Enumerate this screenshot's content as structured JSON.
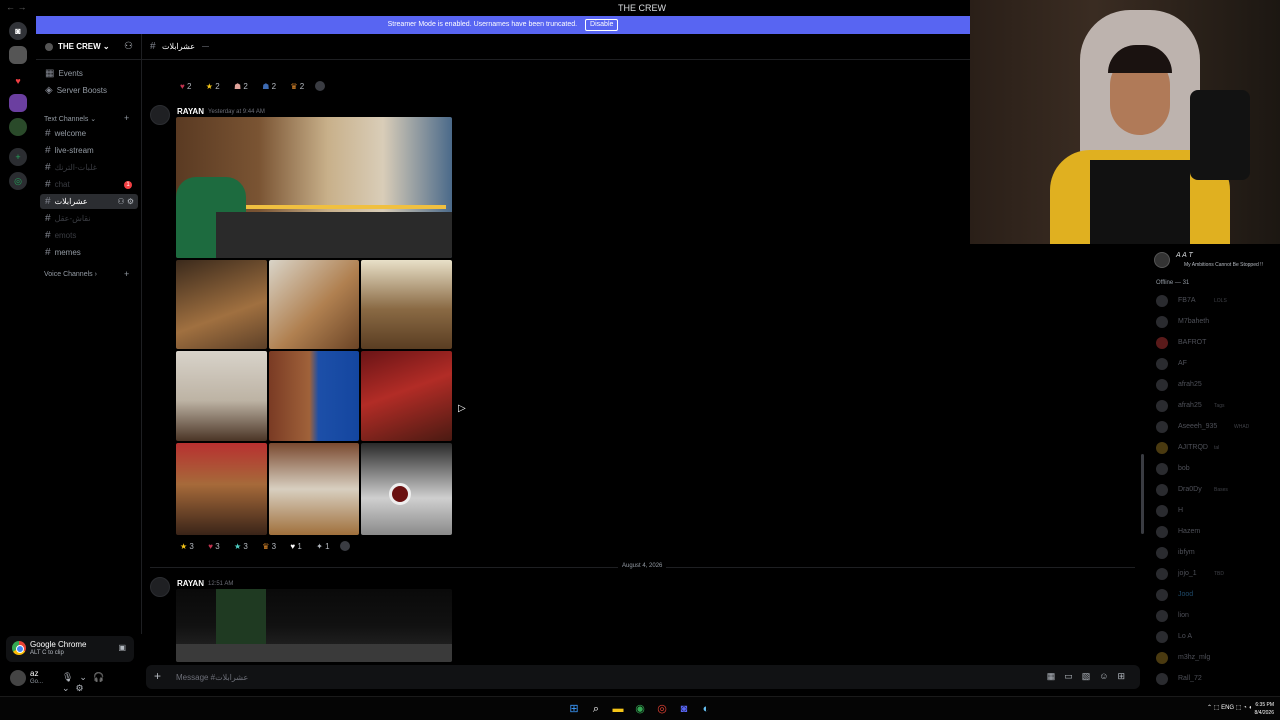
{
  "window": {
    "title": "THE CREW"
  },
  "banner": {
    "text": "Streamer Mode is enabled. Usernames have been truncated.",
    "button": "Disable"
  },
  "server": {
    "name": "THE CREW"
  },
  "sidebar": {
    "top_items": [
      "Events",
      "Server Boosts"
    ],
    "text_category": "Text Channels",
    "channels": [
      {
        "name": "welcome"
      },
      {
        "name": "live-stream"
      },
      {
        "name": "غلبات-الترنك"
      },
      {
        "name": "chat",
        "badge": "1"
      },
      {
        "name": "عشرابلات"
      },
      {
        "name": "نقاش-عقل"
      },
      {
        "name": "emots"
      },
      {
        "name": "memes"
      }
    ],
    "voice_category": "Voice Channels"
  },
  "chat": {
    "channel": "عشرابلات",
    "top_reactions": [
      {
        "emoji": "♥",
        "count": "2",
        "color": "#c2334f"
      },
      {
        "emoji": "★",
        "count": "2",
        "color": "#f5c518"
      },
      {
        "emoji": "☗",
        "count": "2",
        "color": "#e0a39a"
      },
      {
        "emoji": "☗",
        "count": "2",
        "color": "#3d6bb3"
      },
      {
        "emoji": "♛",
        "count": "2",
        "color": "#e08a2b"
      }
    ],
    "messages": [
      {
        "author": "RAYAN",
        "time": "Yesterday at 9:44 AM"
      },
      {
        "author": "RAYAN",
        "time": "12:51 AM"
      }
    ],
    "msg_reactions": [
      {
        "emoji": "★",
        "count": "3",
        "color": "#f5c518"
      },
      {
        "emoji": "♥",
        "count": "3",
        "color": "#c2334f"
      },
      {
        "emoji": "★",
        "count": "3",
        "color": "#4fd1c5"
      },
      {
        "emoji": "♛",
        "count": "3",
        "color": "#e08a2b"
      },
      {
        "emoji": "♥",
        "count": "1",
        "color": "#ffffff"
      },
      {
        "emoji": "✦",
        "count": "1",
        "color": "#b5bac1"
      }
    ],
    "date_divider": "August 4, 2026",
    "composer_placeholder": "Message #عشرابلات"
  },
  "clip": {
    "title": "Google Chrome",
    "subtitle": "ALT  C  to clip"
  },
  "user": {
    "name": "az",
    "status": "Go..."
  },
  "members": {
    "profile": {
      "name": "A A T",
      "bio": "My Ambitions Cannot Be Stopped !!"
    },
    "offline_header": "Offline — 31",
    "list": [
      {
        "name": "FB7A",
        "tag": "LOLS"
      },
      {
        "name": "M7baheth",
        "tag": ""
      },
      {
        "name": "BAFROT",
        "tag": ""
      },
      {
        "name": "AF",
        "tag": ""
      },
      {
        "name": "afrah25",
        "tag": ""
      },
      {
        "name": "afrah25",
        "tag": "Tags"
      },
      {
        "name": "Aseeeh_935",
        "tag": "WHAD"
      },
      {
        "name": "AJITRQD",
        "tag": "tal"
      },
      {
        "name": "bob",
        "tag": ""
      },
      {
        "name": "Dra0Dy",
        "tag": "Bases"
      },
      {
        "name": "H",
        "tag": ""
      },
      {
        "name": "Hazem",
        "tag": ""
      },
      {
        "name": "ibfym",
        "tag": ""
      },
      {
        "name": "jojo_1",
        "tag": "TBD"
      },
      {
        "name": "Jood",
        "tag": ""
      },
      {
        "name": "lion",
        "tag": ""
      },
      {
        "name": "Lo A",
        "tag": ""
      },
      {
        "name": "m3hz_mlg",
        "tag": ""
      },
      {
        "name": "Rall_72",
        "tag": ""
      }
    ]
  },
  "taskbar": {
    "lang": "ENG",
    "time": "6:35 PM",
    "date": "8/4/2026"
  }
}
